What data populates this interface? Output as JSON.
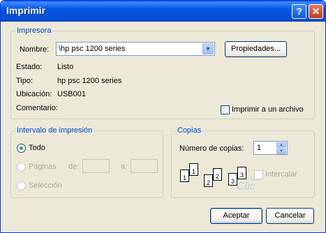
{
  "window": {
    "title": "Imprimir",
    "help_glyph": "?",
    "close_glyph": "✕"
  },
  "printer": {
    "group_label": "Impresora",
    "name_label": "Nombre:",
    "name_value": "\\hp psc 1200 series",
    "properties_button": "Propiedades...",
    "status_label": "Estado:",
    "status_value": "Listo",
    "type_label": "Tipo:",
    "type_value": "hp psc 1200 series",
    "location_label": "Ubicación:",
    "location_value": "USB001",
    "comment_label": "Comentario:",
    "print_to_file_label": "Imprimir a un archivo",
    "print_to_file_checked": false
  },
  "range": {
    "group_label": "Intervalo de impresión",
    "all_label": "Todo",
    "pages_label": "Páginas",
    "from_label": "de:",
    "to_label": "a:",
    "selection_label": "Selección",
    "selected": "all"
  },
  "copies": {
    "group_label": "Copias",
    "count_label": "Número de copias:",
    "count_value": "1",
    "collate_label": "Intercalar",
    "collate_checked": false,
    "page_numbers": [
      "1",
      "2",
      "3"
    ]
  },
  "watermark": {
    "top": "aula",
    "main": "Clic"
  },
  "buttons": {
    "accept": "Aceptar",
    "cancel": "Cancelar"
  },
  "icons": {
    "select_arrow": "▼",
    "spin_up": "▲",
    "spin_down": "▼"
  },
  "colors": {
    "accent_blue": "#0046d5",
    "titlebar": "#0856e0",
    "dialog_bg": "#ece9d8"
  }
}
